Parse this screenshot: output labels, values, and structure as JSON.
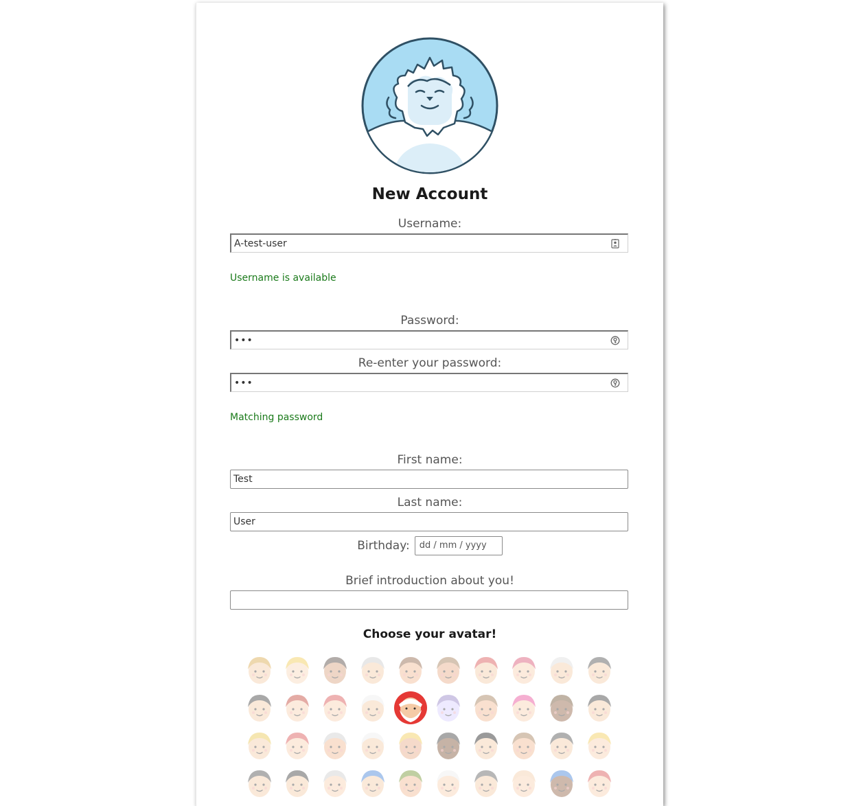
{
  "form": {
    "title": "New Account",
    "username": {
      "label": "Username:",
      "value": "A-test-user",
      "status": "Username is available",
      "icon": "contact-card-icon"
    },
    "password": {
      "label": "Password:",
      "value": "•••",
      "icon": "password-key-icon"
    },
    "password_confirm": {
      "label": "Re-enter your password:",
      "value": "•••",
      "status": "Matching password",
      "icon": "password-key-icon"
    },
    "first_name": {
      "label": "First name:",
      "value": "Test"
    },
    "last_name": {
      "label": "Last name:",
      "value": "User"
    },
    "birthday": {
      "label": "Birthday:",
      "placeholder": "dd / mm / yyyy"
    },
    "intro": {
      "label": "Brief introduction about you!",
      "value": ""
    },
    "avatar_picker": {
      "heading": "Choose your avatar!",
      "selected_index": 14,
      "avatars": [
        {
          "name": "avatar-mustache-hat"
        },
        {
          "name": "avatar-blonde"
        },
        {
          "name": "avatar-bun-woman"
        },
        {
          "name": "avatar-glasses-man"
        },
        {
          "name": "avatar-cowboy"
        },
        {
          "name": "avatar-bearded-man"
        },
        {
          "name": "avatar-hijab-woman"
        },
        {
          "name": "avatar-pink-hair-girl"
        },
        {
          "name": "avatar-old-man-beard"
        },
        {
          "name": "avatar-bald-man-earring"
        },
        {
          "name": "avatar-pirate"
        },
        {
          "name": "avatar-sunglasses-punk"
        },
        {
          "name": "avatar-mohawk-baby"
        },
        {
          "name": "avatar-grandma-glasses"
        },
        {
          "name": "avatar-santa"
        },
        {
          "name": "avatar-purple-hair-woman"
        },
        {
          "name": "avatar-bald-man"
        },
        {
          "name": "avatar-pink-haired-woman"
        },
        {
          "name": "avatar-dark-skin-glasses"
        },
        {
          "name": "avatar-dark-hair-woman"
        },
        {
          "name": "avatar-conical-hat"
        },
        {
          "name": "avatar-redhead-woman"
        },
        {
          "name": "avatar-tribal-headdress"
        },
        {
          "name": "avatar-nurse"
        },
        {
          "name": "avatar-pigtails-girl"
        },
        {
          "name": "avatar-curly-woman"
        },
        {
          "name": "avatar-geisha"
        },
        {
          "name": "avatar-bald-man-2"
        },
        {
          "name": "avatar-star-hair-woman"
        },
        {
          "name": "avatar-blonde-glasses"
        },
        {
          "name": "avatar-nun"
        },
        {
          "name": "avatar-ninja"
        },
        {
          "name": "avatar-headphones-sunglasses"
        },
        {
          "name": "avatar-graduate"
        },
        {
          "name": "avatar-explorer"
        },
        {
          "name": "avatar-turban"
        },
        {
          "name": "avatar-goggles"
        },
        {
          "name": "avatar-baby"
        },
        {
          "name": "avatar-cap-man"
        },
        {
          "name": "avatar-red-cap"
        }
      ]
    }
  },
  "colors": {
    "status_ok": "#1a7a1a",
    "logo_bg": "#a9dcf3",
    "logo_stroke": "#2f5064"
  }
}
